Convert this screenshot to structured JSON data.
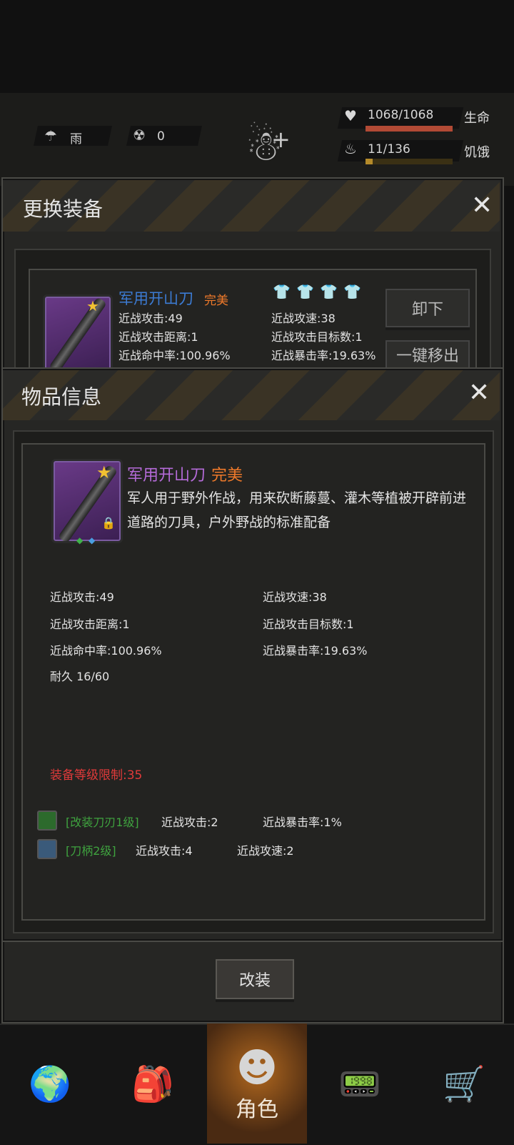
{
  "status": {
    "weather_label": "雨",
    "radiation_value": "0",
    "health_value": "1068/1068",
    "health_label": "生命",
    "health_fraction": 1.0,
    "hunger_value": "11/136",
    "hunger_label": "饥饿",
    "hunger_fraction": 0.08
  },
  "equip_dialog": {
    "title": "更换装备",
    "item_name": "军用开山刀",
    "item_quality": "完美",
    "stats_left": [
      "近战攻击:49",
      "近战攻击距离:1",
      "近战命中率:100.96%"
    ],
    "stats_right": [
      "近战攻速:38",
      "近战攻击目标数:1",
      "近战暴击率:19.63%"
    ],
    "unequip_label": "卸下",
    "quick_remove_label": "一键移出"
  },
  "item_info": {
    "title": "物品信息",
    "name": "军用开山刀",
    "quality": "完美",
    "description": "军人用于野外作战，用来砍断藤蔓、灌木等植被开辟前进道路的刀具，户外野战的标准配备",
    "stats": [
      [
        "近战攻击:49",
        "近战攻速:38"
      ],
      [
        "近战攻击距离:1",
        "近战攻击目标数:1"
      ],
      [
        "近战命中率:100.96%",
        "近战暴击率:19.63%"
      ]
    ],
    "durability": "耐久 16/60",
    "level_limit": "装备等级限制:35",
    "mods": [
      {
        "name": "[改装刀刃1级]",
        "stat1": "近战攻击:2",
        "stat2": "近战暴击率:1%",
        "color": "#3fa33f"
      },
      {
        "name": "[刀柄2级]",
        "stat1": "近战攻击:4",
        "stat2": "近战攻速:2",
        "color": "#3fa33f"
      }
    ],
    "modify_button": "改装"
  },
  "bottom_nav": {
    "items": [
      {
        "icon": "globe-icon"
      },
      {
        "icon": "backpack-icon"
      },
      {
        "icon": "character-icon",
        "label": "角色",
        "active": true
      },
      {
        "icon": "radio-icon"
      },
      {
        "icon": "cart-icon"
      }
    ]
  }
}
